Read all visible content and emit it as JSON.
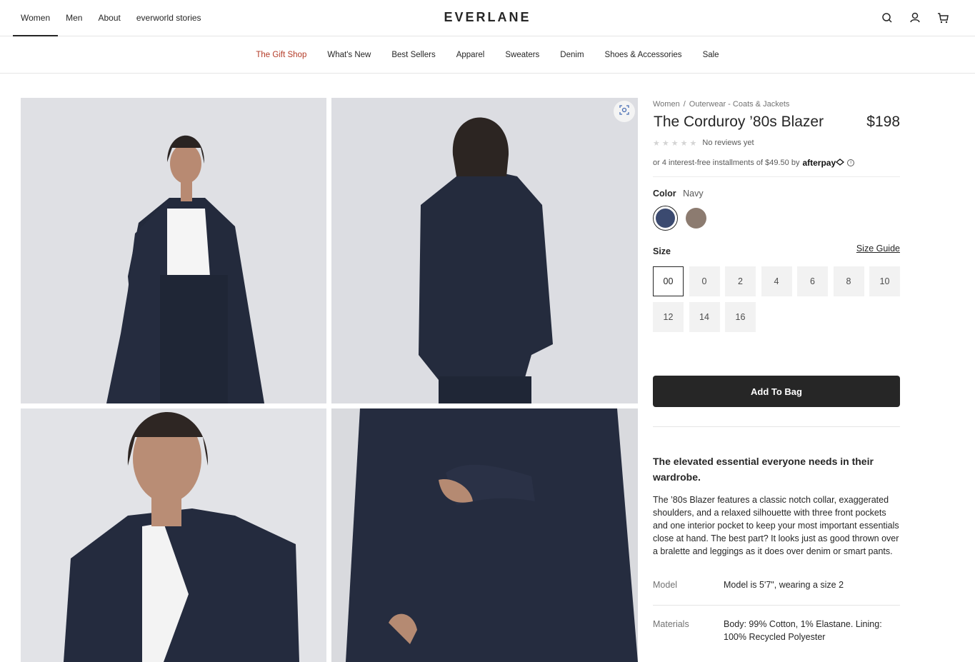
{
  "header": {
    "nav": [
      "Women",
      "Men",
      "About",
      "everworld stories"
    ],
    "active_nav": "Women",
    "logo": "EVERLANE",
    "icons": [
      "search-icon",
      "account-icon",
      "cart-icon"
    ]
  },
  "category_nav": [
    "The Gift Shop",
    "What's New",
    "Best Sellers",
    "Apparel",
    "Sweaters",
    "Denim",
    "Shoes & Accessories",
    "Sale"
  ],
  "gallery": {
    "images": [
      "front-view",
      "back-view",
      "detail-collar",
      "detail-sleeve"
    ],
    "zoom_icon": "zoom-icon"
  },
  "product": {
    "breadcrumb": [
      "Women",
      "Outerwear - Coats & Jackets"
    ],
    "breadcrumb_sep": "/",
    "title": "The Corduroy ’80s Blazer",
    "price": "$198",
    "rating": 0,
    "reviews_text": "No reviews yet",
    "installments_text": "or 4 interest-free installments of $49.50 by",
    "afterpay_brand": "afterpay",
    "color_label": "Color",
    "color_value": "Navy",
    "colors": [
      {
        "name": "Navy",
        "hex": "#3b4a70",
        "selected": true
      },
      {
        "name": "Taupe",
        "hex": "#8c7b70",
        "selected": false
      }
    ],
    "size_label": "Size",
    "size_guide": "Size Guide",
    "sizes": [
      "00",
      "0",
      "2",
      "4",
      "6",
      "8",
      "10",
      "12",
      "14",
      "16"
    ],
    "selected_size": "00",
    "add_to_bag": "Add To Bag",
    "headline": "The elevated essential everyone needs in their wardrobe.",
    "description": "The ’80s Blazer features a classic notch collar, exaggerated shoulders, and a relaxed silhouette with three front pockets and one interior pocket to keep your most important essentials close at hand. The best part? It looks just as good thrown over a bralette and leggings as it does over denim or smart pants.",
    "model_label": "Model",
    "model_value": "Model is 5'7\", wearing a size 2",
    "materials_label": "Materials",
    "materials_value": "Body: 99% Cotton, 1% Elastane. Lining: 100% Recycled Polyester"
  }
}
